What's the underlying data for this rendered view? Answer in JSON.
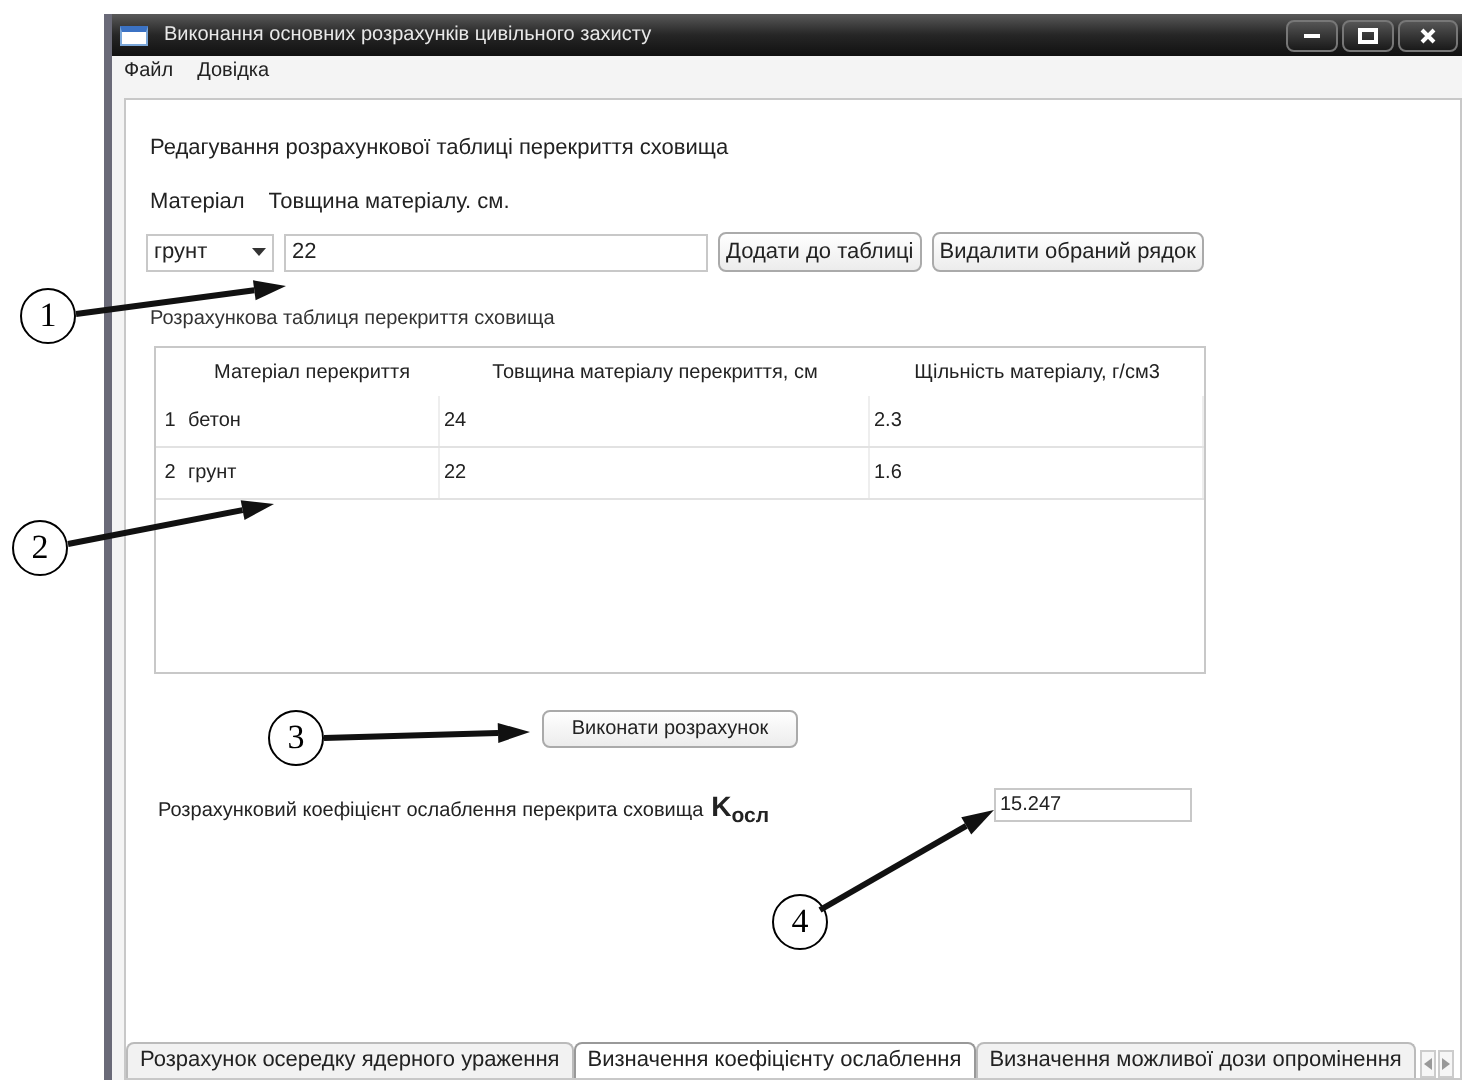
{
  "window": {
    "title": "Виконання основних розрахунків цивільного захисту"
  },
  "menu": [
    "Файл",
    "Довідка"
  ],
  "editor": {
    "heading": "Редагування розрахункової таблиці перекриття сховища",
    "material_label": "Матеріал",
    "thickness_label": "Товщина матеріалу. см.",
    "material": "грунт",
    "thickness": "22",
    "buttons": [
      "Додати до таблиці",
      "Видалити обраний рядок"
    ]
  },
  "table": {
    "title": "Розрахункова таблиця перекриття сховища",
    "columns": [
      "Матеріал перекриття",
      "Товщина матеріалу перекриття, см",
      "Щільність матеріалу, г/см3"
    ],
    "rows": [
      {
        "number": "1",
        "cells": [
          "бетон",
          "24",
          "2.3"
        ]
      },
      {
        "number": "2",
        "cells": [
          "грунт",
          "22",
          "1.6"
        ]
      }
    ]
  },
  "calculate_button": "Виконати розрахунок",
  "result": {
    "label": "Розрахунковий коефіцієнт ослаблення перекрита сховища",
    "symbol": "K$_{осл}$",
    "value": "15.247"
  },
  "tabs": [
    {
      "label": "Розрахунок осередку ядерного ураження",
      "selected": false
    },
    {
      "label": "Визначення коефіцієнту ослаблення",
      "selected": true
    },
    {
      "label": "Визначення можливої дози опромінення",
      "selected": false
    }
  ],
  "callouts": [
    "1",
    "2",
    "3",
    "4"
  ]
}
